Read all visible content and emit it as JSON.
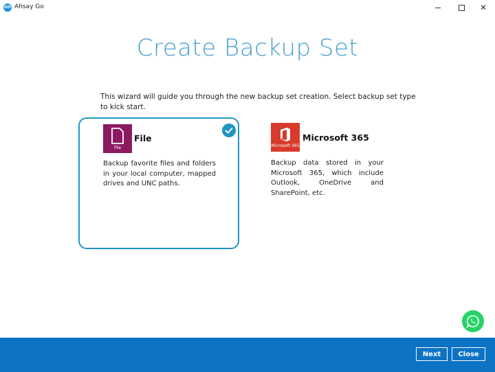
{
  "window": {
    "app_icon_text": "GO",
    "title": "Ahsay Go"
  },
  "page": {
    "title": "Create Backup Set",
    "intro": "This wizard will guide you through the new backup set creation. Select backup set type to kick start."
  },
  "backup_types": [
    {
      "name": "File",
      "icon_caption": "File",
      "description": "Backup favorite files and folders in your local computer, mapped drives and UNC paths.",
      "selected": true
    },
    {
      "name": "Microsoft 365",
      "icon_caption": "Microsoft 365",
      "description": "Backup data stored in your Microsoft 365, which include Outlook, OneDrive and SharePoint, etc.",
      "selected": false
    }
  ],
  "footer": {
    "next_label": "Next",
    "close_label": "Close"
  },
  "colors": {
    "accent": "#1f95c4",
    "footer_bg": "#0d73c4",
    "file_tile": "#8c1a62",
    "m365_tile": "#d83b2b",
    "whatsapp": "#25d366"
  }
}
